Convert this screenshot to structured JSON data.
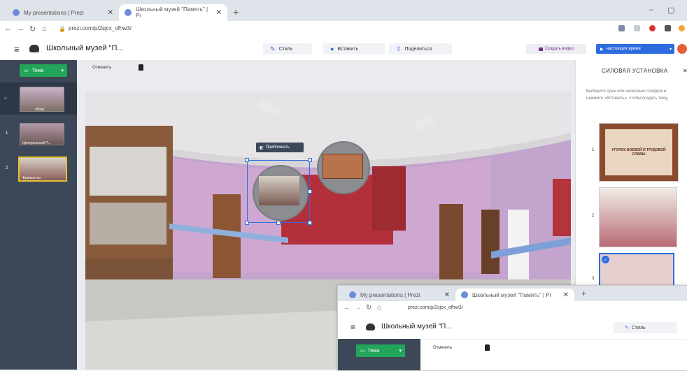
{
  "browser": {
    "tabs": [
      {
        "title": "My presentations | Prezi",
        "active": false
      },
      {
        "title": "Школьный музей \"Память\" | Pr",
        "active": true
      }
    ],
    "new_tab_symbol": "+",
    "url": "prezi.com/p/2sjcx_ofhw3/"
  },
  "app": {
    "menu_symbol": "≡",
    "title": "Школьный музей \"П...",
    "toolbar": {
      "style": "Стиль",
      "insert": "Вставить",
      "share": "Поделиться"
    },
    "video_button": "Создать видео",
    "present_button": "настоящих время",
    "undo": "Отменить"
  },
  "sidebar": {
    "theme_button": "Тема",
    "slides": [
      {
        "num": "",
        "caption": "обзор"
      },
      {
        "num": "1",
        "caption": "Центральный П..."
      },
      {
        "num": "2",
        "caption": "Фрагменты"
      }
    ]
  },
  "canvas": {
    "tooltip": "Приближать"
  },
  "right_panel": {
    "title": "СИЛОВАЯ УСТАНОВКА",
    "description": "Выберите один или несколько слайдов и нажмите «Вставить», чтобы создать тему.",
    "slides": [
      {
        "num": "1",
        "caption": "УГОЛОК БОЕВОЙ И ТРУДОВОЙ СЛАВЫ",
        "selected": false
      },
      {
        "num": "2",
        "caption": "",
        "selected": false
      },
      {
        "num": "3",
        "caption": "",
        "selected": true
      }
    ]
  },
  "overlay": {
    "tabs": [
      {
        "title": "My presentations | Prezi"
      },
      {
        "title": "Школьный музей \"Память\" | Pr"
      }
    ],
    "url": "prezi.com/p/2sjcx_ofhw3/",
    "title": "Школьный музей \"П...",
    "style": "Стиль",
    "theme_button": "Тема",
    "undo": "Отменить"
  },
  "colors": {
    "accent": "#2d6cdf",
    "theme_green": "#23a55a",
    "sidebar": "#3c4758"
  }
}
